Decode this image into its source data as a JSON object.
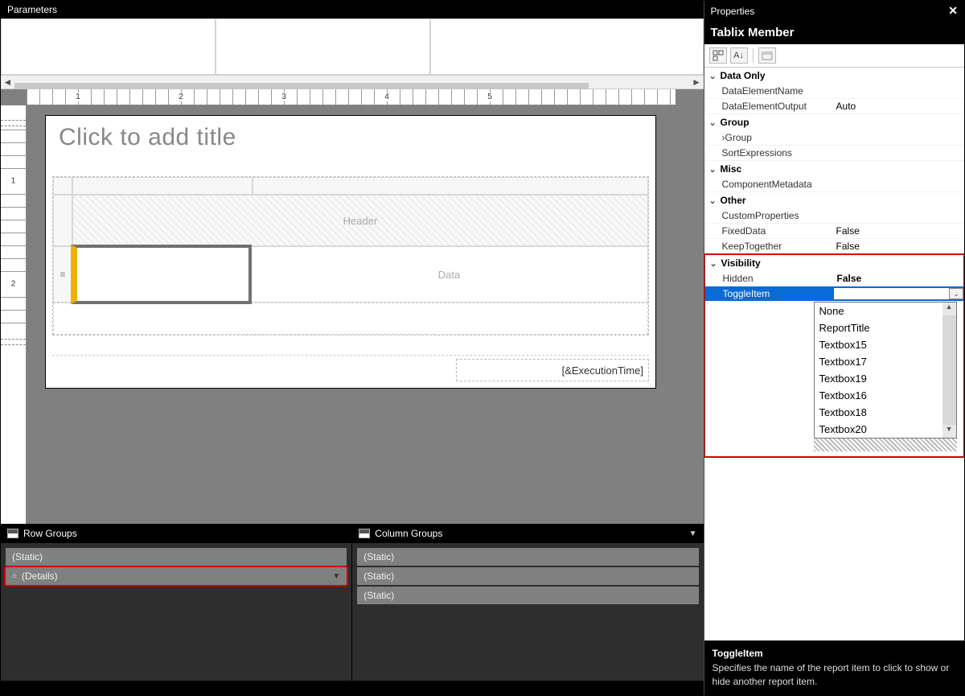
{
  "parameters": {
    "title": "Parameters"
  },
  "design": {
    "titlePlaceholder": "Click to add title",
    "headerLabel": "Header",
    "dataLabel": "Data",
    "footerExpr": "[&ExecutionTime]",
    "rulerLabels": [
      "1",
      "2",
      "3",
      "4",
      "5"
    ]
  },
  "rowGroups": {
    "title": "Row Groups",
    "items": [
      {
        "label": "(Static)",
        "selected": false,
        "hasDropdown": false
      },
      {
        "label": "(Details)",
        "selected": true,
        "hasDropdown": true
      }
    ]
  },
  "colGroups": {
    "title": "Column Groups",
    "items": [
      {
        "label": "(Static)"
      },
      {
        "label": "(Static)"
      },
      {
        "label": "(Static)"
      }
    ]
  },
  "properties": {
    "title": "Properties",
    "object": "Tablix Member",
    "categories": [
      {
        "name": "Data Only",
        "rows": [
          {
            "name": "DataElementName",
            "value": ""
          },
          {
            "name": "DataElementOutput",
            "value": "Auto"
          }
        ]
      },
      {
        "name": "Group",
        "rows": [
          {
            "name": "Group",
            "value": "",
            "expandable": true
          },
          {
            "name": "SortExpressions",
            "value": ""
          }
        ]
      },
      {
        "name": "Misc",
        "rows": [
          {
            "name": "ComponentMetadata",
            "value": ""
          }
        ]
      },
      {
        "name": "Other",
        "rows": [
          {
            "name": "CustomProperties",
            "value": ""
          },
          {
            "name": "FixedData",
            "value": "False"
          },
          {
            "name": "KeepTogether",
            "value": "False"
          }
        ]
      },
      {
        "name": "Visibility",
        "highlighted": true,
        "rows": [
          {
            "name": "Hidden",
            "value": "False",
            "bold": true
          },
          {
            "name": "ToggleItem",
            "value": "",
            "selected": true
          }
        ]
      }
    ],
    "dropdown": [
      "None",
      "ReportTitle",
      "Textbox15",
      "Textbox17",
      "Textbox19",
      "Textbox16",
      "Textbox18",
      "Textbox20"
    ],
    "help": {
      "title": "ToggleItem",
      "text": "Specifies the name of the report item to click to show or hide another report item."
    }
  }
}
